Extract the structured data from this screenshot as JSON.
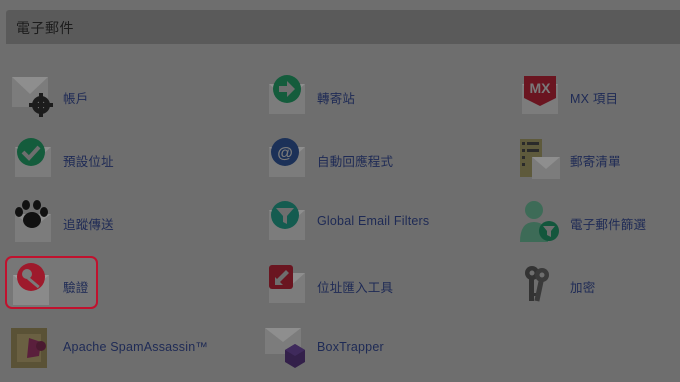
{
  "section": {
    "title": "電子郵件"
  },
  "items": [
    {
      "label": "帳戶",
      "icon": "account-settings-icon"
    },
    {
      "label": "轉寄站",
      "icon": "forwarders-icon"
    },
    {
      "label": "MX 項目",
      "icon": "mx-entry-icon",
      "icon_text": "MX"
    },
    {
      "label": "預設位址",
      "icon": "default-address-icon"
    },
    {
      "label": "自動回應程式",
      "icon": "autoresponders-icon"
    },
    {
      "label": "郵寄清單",
      "icon": "mailing-lists-icon"
    },
    {
      "label": "追蹤傳送",
      "icon": "track-delivery-icon"
    },
    {
      "label": "Global Email Filters",
      "icon": "global-filters-icon"
    },
    {
      "label": "電子郵件篩選",
      "icon": "email-filters-icon"
    },
    {
      "label": "驗證",
      "icon": "authentication-icon",
      "highlighted": true
    },
    {
      "label": "位址匯入工具",
      "icon": "address-importer-icon"
    },
    {
      "label": "加密",
      "icon": "encryption-icon"
    },
    {
      "label": "Apache SpamAssassin™",
      "icon": "spamassassin-icon"
    },
    {
      "label": "BoxTrapper",
      "icon": "boxtrapper-icon"
    }
  ],
  "colors": {
    "highlight": "#c0122e",
    "link": "#1e2a55",
    "background": "#6e6e6e"
  }
}
